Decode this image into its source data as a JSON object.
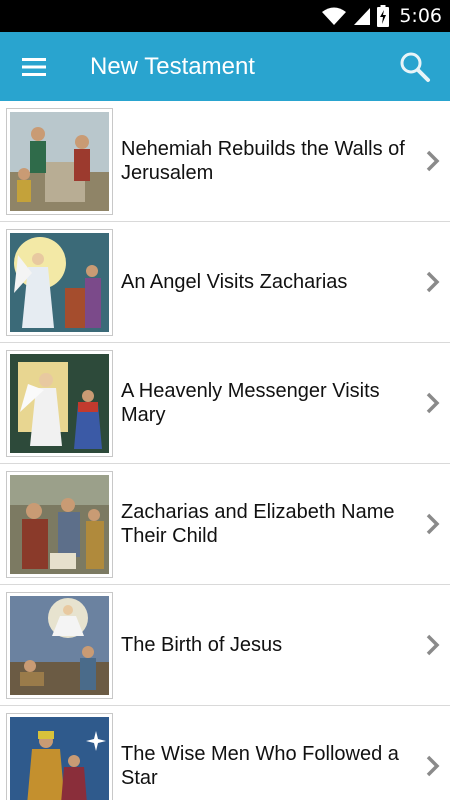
{
  "status_bar": {
    "time": "5:06",
    "icons": [
      "wifi-icon",
      "cell-signal-icon",
      "battery-charging-icon"
    ]
  },
  "app_bar": {
    "title": "New Testament",
    "menu_icon": "hamburger-menu-icon",
    "search_icon": "search-icon",
    "color": "#29a4cf"
  },
  "stories": [
    {
      "title": "Nehemiah Rebuilds the Walls of Jerusalem"
    },
    {
      "title": "An Angel Visits Zacharias"
    },
    {
      "title": "A Heavenly Messenger Visits Mary"
    },
    {
      "title": "Zacharias and Elizabeth Name Their Child"
    },
    {
      "title": "The Birth of Jesus"
    },
    {
      "title": "The Wise Men Who Followed a Star"
    }
  ]
}
